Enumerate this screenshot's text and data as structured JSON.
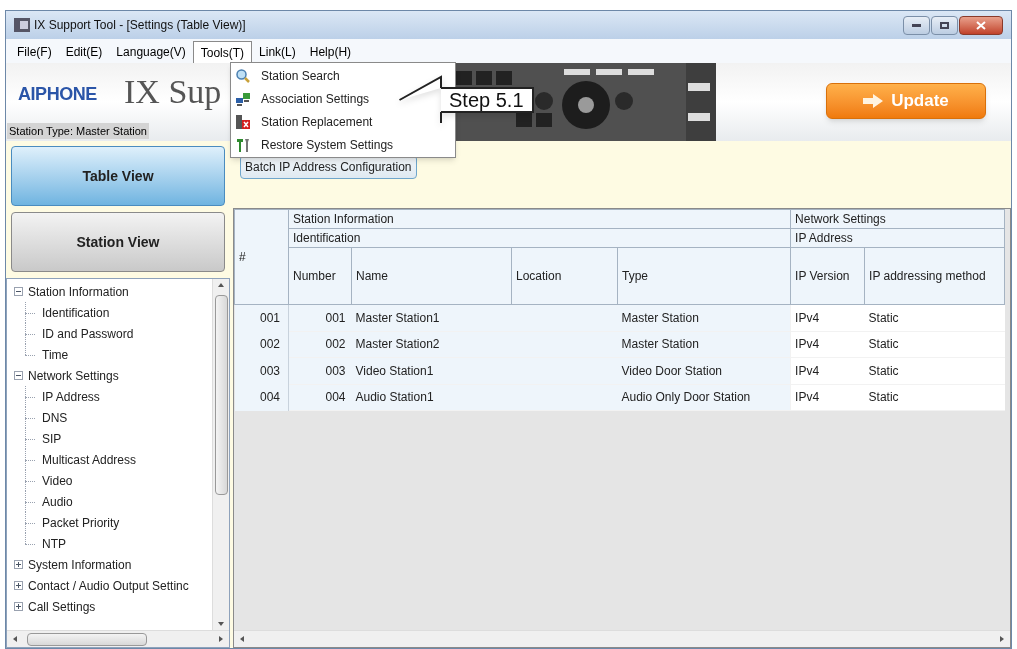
{
  "window": {
    "title": "IX Support Tool - [Settings (Table View)]"
  },
  "menu": [
    {
      "label": "File(F)",
      "selected": false
    },
    {
      "label": "Edit(E)",
      "selected": false
    },
    {
      "label": "Language(V)",
      "selected": false
    },
    {
      "label": "Tools(T)",
      "selected": true
    },
    {
      "label": "Link(L)",
      "selected": false
    },
    {
      "label": "Help(H)",
      "selected": false
    }
  ],
  "tools_menu": [
    {
      "label": "Station Search",
      "kind": "search"
    },
    {
      "label": "Association Settings",
      "kind": "association"
    },
    {
      "label": "Station Replacement",
      "kind": "replace"
    },
    {
      "label": "Restore System Settings",
      "kind": "restore"
    }
  ],
  "callout": {
    "text": "Step 5.1"
  },
  "header": {
    "brand": "AIPHONE",
    "product": "IX Sup",
    "station_type": "Station Type:  Master Station",
    "update_button": "Update"
  },
  "view_buttons": [
    {
      "label": "Table View",
      "selected": true
    },
    {
      "label": "Station View",
      "selected": false
    }
  ],
  "batch_button": "Batch IP Address Configuration",
  "tree": [
    {
      "label": "Station Information",
      "expanded": true,
      "children": [
        {
          "label": "Identification"
        },
        {
          "label": "ID and Password"
        },
        {
          "label": "Time"
        }
      ]
    },
    {
      "label": "Network Settings",
      "expanded": true,
      "children": [
        {
          "label": "IP Address"
        },
        {
          "label": "DNS"
        },
        {
          "label": "SIP"
        },
        {
          "label": "Multicast Address"
        },
        {
          "label": "Video"
        },
        {
          "label": "Audio"
        },
        {
          "label": "Packet Priority"
        },
        {
          "label": "NTP"
        }
      ]
    },
    {
      "label": "System Information",
      "expanded": false
    },
    {
      "label": "Contact / Audio Output Settinc",
      "expanded": false
    },
    {
      "label": "Call Settings",
      "expanded": false
    }
  ],
  "table": {
    "groups": [
      "Station Information",
      "Network Settings"
    ],
    "subgroups": [
      "Identification",
      "IP Address"
    ],
    "index_header": "#",
    "columns": [
      "Number",
      "Name",
      "Location",
      "Type",
      "IP Version",
      "IP addressing method"
    ],
    "rows": [
      {
        "index": "001",
        "cells": [
          "001",
          "Master Station1",
          "",
          "Master Station",
          "IPv4",
          "Static"
        ]
      },
      {
        "index": "002",
        "cells": [
          "002",
          "Master Station2",
          "",
          "Master Station",
          "IPv4",
          "Static"
        ]
      },
      {
        "index": "003",
        "cells": [
          "003",
          "Video Station1",
          "",
          "Video Door Station",
          "IPv4",
          "Static"
        ]
      },
      {
        "index": "004",
        "cells": [
          "004",
          "Audio Station1",
          "",
          "Audio Only Door Station",
          "IPv4",
          "Static"
        ]
      }
    ]
  }
}
